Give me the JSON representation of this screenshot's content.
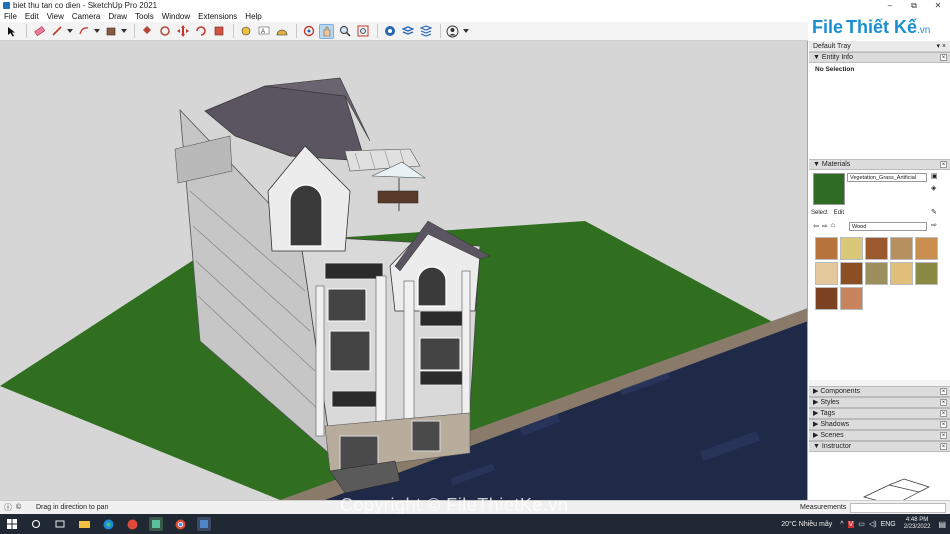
{
  "window": {
    "title": "biet thu tan co dien - SketchUp Pro 2021",
    "minimize": "–",
    "maximize": "⧉",
    "close": "✕"
  },
  "menu": [
    "File",
    "Edit",
    "View",
    "Camera",
    "Draw",
    "Tools",
    "Window",
    "Extensions",
    "Help"
  ],
  "logo": {
    "part1": "File",
    "part2": "Thiết Kế",
    "part3": ".vn"
  },
  "toolbar": {
    "tools": [
      "select-icon",
      "eraser-icon",
      "pencil-icon",
      "shapes-icon",
      "paint-bucket-icon",
      "push-pull-icon",
      "follow-me-icon",
      "move-icon",
      "rotate-icon",
      "scale-icon",
      "tape-measure-icon",
      "text-icon",
      "protractor-icon",
      "orbit-icon",
      "pan-icon",
      "zoom-icon",
      "zoom-extents-icon",
      "warehouse-icon",
      "extension-icon",
      "layout-icon",
      "profile-icon"
    ]
  },
  "tray": {
    "title": "Default Tray",
    "entity_info": {
      "label": "Entity Info",
      "value": "No Selection"
    },
    "materials": {
      "label": "Materials",
      "current_material": "Vegetation_Grass_Artificial",
      "tab_select": "Select",
      "tab_edit": "Edit",
      "library": "Wood",
      "swatch_colors": [
        "#b8743d",
        "#d9c878",
        "#9b5a2e",
        "#b7905f",
        "#c98f4f",
        "#e2c89b",
        "#8a4f22",
        "#9b8f5d",
        "#e0bf7a",
        "#8b8a45",
        "#7a4220",
        "#c7845c"
      ]
    },
    "panels": [
      "Components",
      "Styles",
      "Tags",
      "Shadows",
      "Scenes",
      "Instructor"
    ]
  },
  "status": {
    "message": "Drag in direction to pan",
    "measurements_label": "Measurements"
  },
  "watermark": "Copyright © FileThietKe.vn",
  "taskbar": {
    "weather": "20°C  Nhiều mây",
    "lang": "ENG",
    "time": "4:48 PM",
    "date": "2/23/2022"
  }
}
